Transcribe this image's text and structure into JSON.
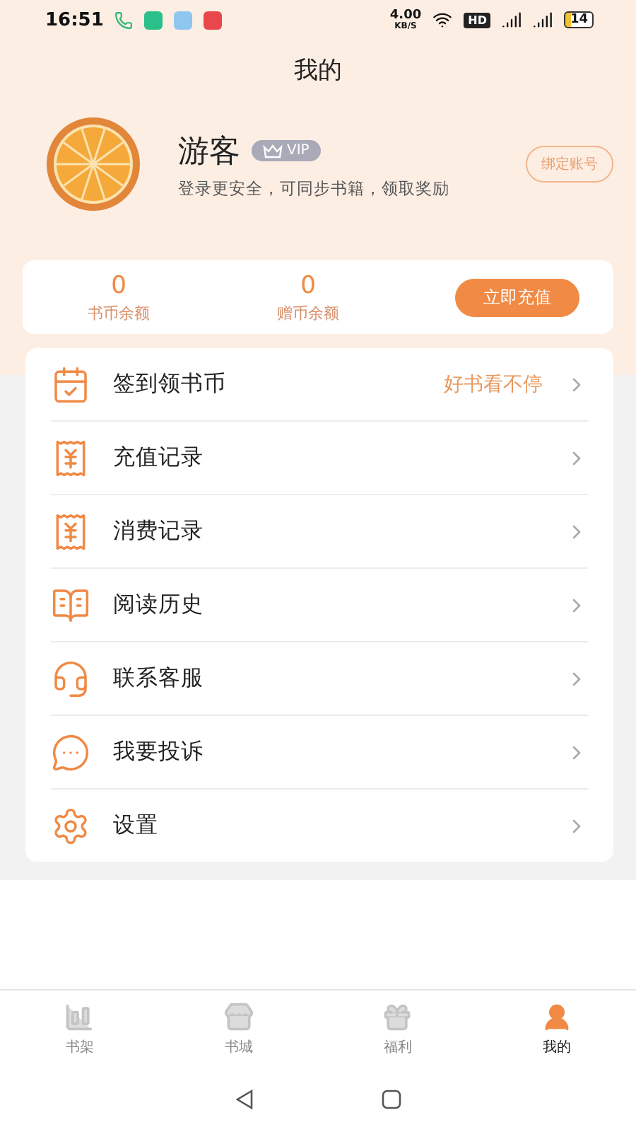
{
  "status_bar": {
    "time": "16:51",
    "speed": "4.00",
    "speed_unit": "KB/S",
    "hd": "HD",
    "battery": "14"
  },
  "title": "我的",
  "profile": {
    "name": "游客",
    "badge": "VIP",
    "subtitle": "登录更安全，可同步书籍，领取奖励",
    "bind_button": "绑定账号"
  },
  "wallet": {
    "balances": [
      {
        "value": "0",
        "label": "书币余额"
      },
      {
        "value": "0",
        "label": "赠币余额"
      }
    ],
    "recharge_button": "立即充值"
  },
  "menu": [
    {
      "kind": "checkin",
      "label": "签到领书币",
      "hint": "好书看不停"
    },
    {
      "kind": "recharge",
      "label": "充值记录"
    },
    {
      "kind": "spend",
      "label": "消费记录"
    },
    {
      "kind": "history",
      "label": "阅读历史"
    },
    {
      "kind": "service",
      "label": "联系客服"
    },
    {
      "kind": "complaint",
      "label": "我要投诉"
    },
    {
      "kind": "settings",
      "label": "设置"
    }
  ],
  "tabs": [
    {
      "kind": "shelf",
      "label": "书架",
      "selected": false
    },
    {
      "kind": "store",
      "label": "书城",
      "selected": false
    },
    {
      "kind": "welfare",
      "label": "福利",
      "selected": false
    },
    {
      "kind": "mine",
      "label": "我的",
      "selected": true
    }
  ]
}
